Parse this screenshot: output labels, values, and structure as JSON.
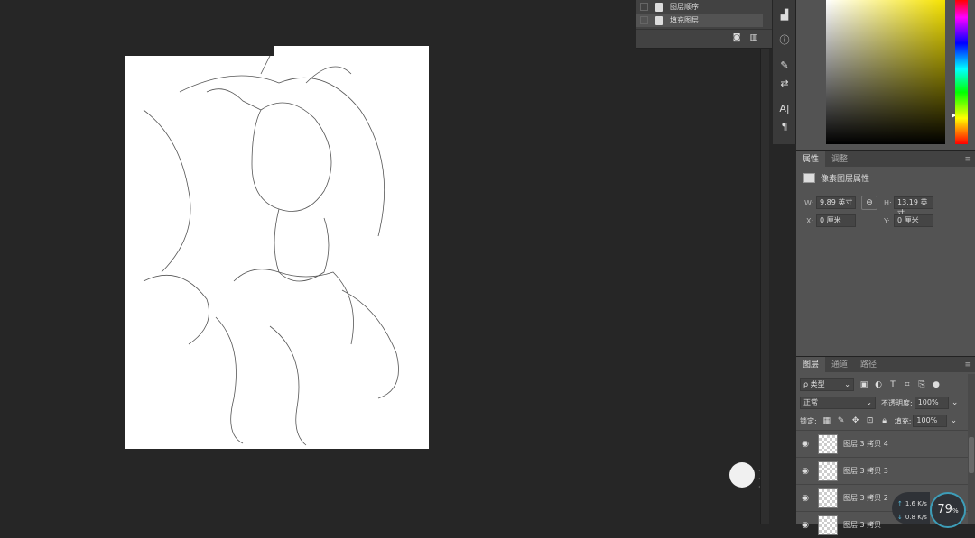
{
  "mini_panel": {
    "rows": [
      {
        "label": "图层顺序"
      },
      {
        "label": "填充图层"
      }
    ],
    "footer_icons": [
      "camera-icon",
      "trash-icon"
    ]
  },
  "tools": [
    "histogram-icon",
    "info-icon",
    "brush-icon",
    "adjust-icon",
    "character-icon",
    "paragraph-icon"
  ],
  "properties_panel": {
    "tabs": [
      "属性",
      "调整"
    ],
    "title": "像素图层属性",
    "w_label": "W:",
    "w_value": "9.89 英寸",
    "h_label": "H:",
    "h_value": "13.19 英寸",
    "x_label": "X:",
    "x_value": "0 厘米",
    "y_label": "Y:",
    "y_value": "0 厘米",
    "link_icon": "link-icon"
  },
  "layers_panel": {
    "tabs": [
      "图层",
      "通道",
      "路径"
    ],
    "filter_label": "ρ 类型",
    "blend_mode": "正常",
    "opacity_label": "不透明度:",
    "opacity_value": "100%",
    "lock_label": "锁定:",
    "fill_label": "填充:",
    "fill_value": "100%",
    "layers": [
      {
        "name": "图层 3 拷贝 4"
      },
      {
        "name": "图层 3 拷贝 3"
      },
      {
        "name": "图层 3 拷贝 2"
      },
      {
        "name": "图层 3 拷贝"
      }
    ]
  },
  "network_widget": {
    "up": "1.6",
    "up_unit": "K/s",
    "down": "0.8",
    "down_unit": "K/s",
    "gauge_value": "79",
    "gauge_unit": "%"
  },
  "colors": {
    "workspace": "#262626",
    "panel": "#535353",
    "accent": "#3d9db8"
  }
}
